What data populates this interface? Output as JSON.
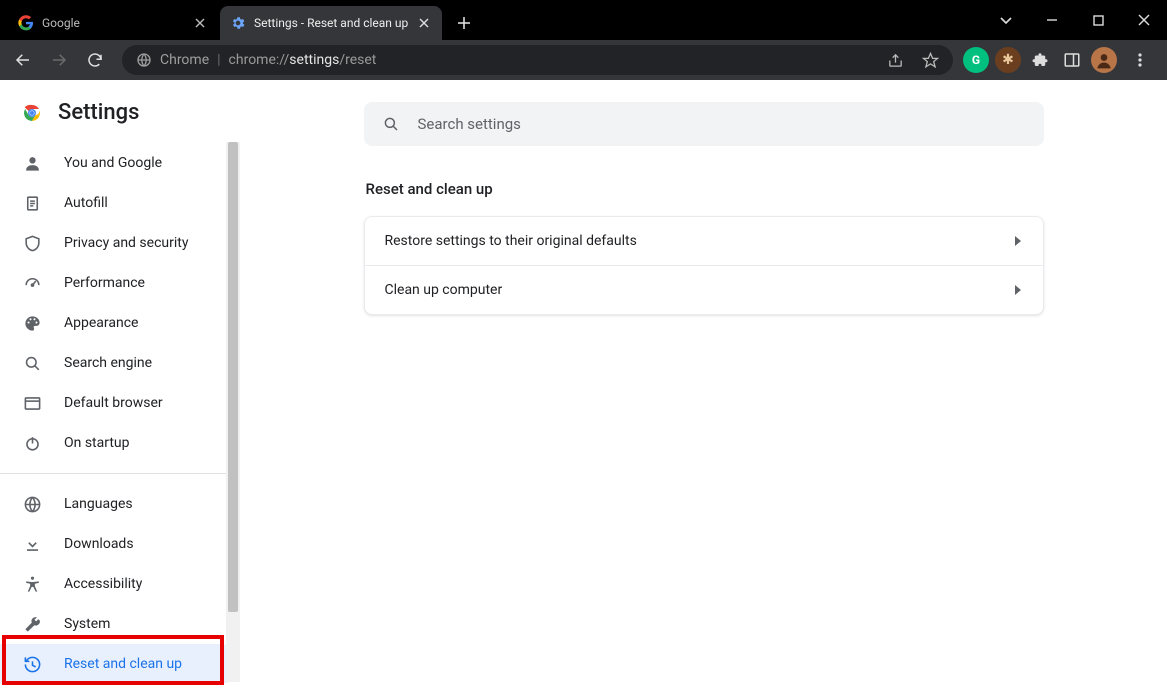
{
  "window": {
    "tabs": [
      {
        "label": "Google",
        "active": false
      },
      {
        "label": "Settings - Reset and clean up",
        "active": true
      }
    ]
  },
  "url": {
    "host_label": "Chrome",
    "path_dim_prefix": "chrome://",
    "path_strong": "settings",
    "path_dim_suffix": "/reset"
  },
  "settings_title": "Settings",
  "sidebar": {
    "group1": [
      {
        "icon": "person",
        "label": "You and Google"
      },
      {
        "icon": "autofill",
        "label": "Autofill"
      },
      {
        "icon": "shield",
        "label": "Privacy and security"
      },
      {
        "icon": "speed",
        "label": "Performance"
      },
      {
        "icon": "palette",
        "label": "Appearance"
      },
      {
        "icon": "search",
        "label": "Search engine"
      },
      {
        "icon": "browser",
        "label": "Default browser"
      },
      {
        "icon": "power",
        "label": "On startup"
      }
    ],
    "group2": [
      {
        "icon": "globe",
        "label": "Languages"
      },
      {
        "icon": "download",
        "label": "Downloads"
      },
      {
        "icon": "accessibility",
        "label": "Accessibility"
      },
      {
        "icon": "wrench",
        "label": "System"
      },
      {
        "icon": "restore",
        "label": "Reset and clean up",
        "selected": true
      }
    ]
  },
  "search": {
    "placeholder": "Search settings"
  },
  "section": {
    "title": "Reset and clean up",
    "rows": [
      "Restore settings to their original defaults",
      "Clean up computer"
    ]
  }
}
